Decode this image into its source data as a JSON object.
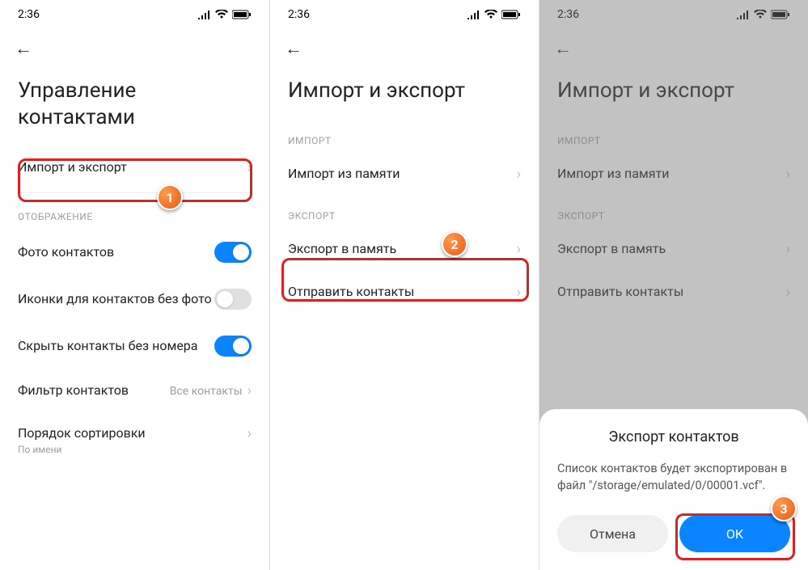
{
  "status": {
    "time": "2:36"
  },
  "badges": {
    "b1": "1",
    "b2": "2",
    "b3": "3"
  },
  "screen1": {
    "title": "Управление контактами",
    "items": {
      "import_export": "Импорт и экспорт",
      "display_section": "ОТОБРАЖЕНИЕ",
      "photo_contacts": "Фото контактов",
      "icons_no_photo": "Иконки для контактов без фото",
      "hide_no_number": "Скрыть контакты без номера",
      "filter": "Фильтр контактов",
      "filter_value": "Все контакты",
      "sort": "Порядок сортировки",
      "sort_value": "По имени"
    }
  },
  "screen2": {
    "title": "Импорт и экспорт",
    "import_section": "ИМПОРТ",
    "import_memory": "Импорт из памяти",
    "export_section": "ЭКСПОРТ",
    "export_memory": "Экспорт в память",
    "send_contacts": "Отправить контакты"
  },
  "screen3": {
    "title": "Импорт и экспорт",
    "import_section": "ИМПОРТ",
    "import_memory": "Импорт из памяти",
    "export_section": "ЭКСПОРТ",
    "export_memory": "Экспорт в память",
    "send_contacts": "Отправить контакты",
    "dialog": {
      "title": "Экспорт контактов",
      "text": "Список контактов будет экспортирован в файл \"/storage/emulated/0/00001.vcf\".",
      "cancel": "Отмена",
      "ok": "ОК"
    }
  }
}
